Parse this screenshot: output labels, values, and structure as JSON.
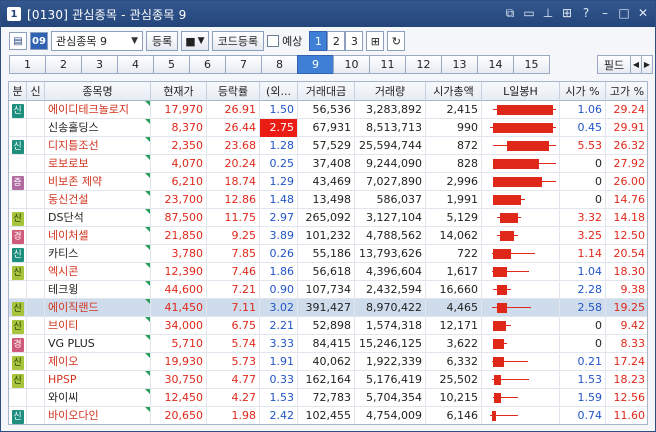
{
  "title": {
    "number": "1",
    "text": "[0130] 관심종목 - 관심종목 9"
  },
  "toolbar": {
    "group_select": "관심종목 9",
    "register": "등록",
    "code_register": "코드등록",
    "forecast": "예상",
    "pages": [
      "1",
      "2",
      "3"
    ],
    "active_page": "1",
    "icon_label_blue": "09"
  },
  "tabs": [
    "1",
    "2",
    "3",
    "4",
    "5",
    "6",
    "7",
    "8",
    "9",
    "10",
    "11",
    "12",
    "13",
    "14",
    "15"
  ],
  "active_tab": "9",
  "tab_field": "필드",
  "columns": [
    "분",
    "신",
    "종목명",
    "현재가",
    "등락률",
    "(외...",
    "거래대금",
    "거래량",
    "시가총액",
    "L일봉H",
    "시가 %",
    "고가 %"
  ],
  "rows": [
    {
      "badge": "신",
      "badge_color": "teal",
      "name": "에이디테크놀로지",
      "name_color": "red",
      "price": "17,970",
      "rate": "26.91",
      "foreign": "1.50",
      "amount": "56,536",
      "volume": "3,283,892",
      "cap": "2,415",
      "open_pct": "1.06",
      "high_pct": "29.24",
      "open_color": "blue",
      "candle": {
        "low": 0.1,
        "high": 1.0,
        "open": 0.15,
        "close": 0.95
      }
    },
    {
      "badge": "",
      "badge_color": "",
      "name": "신송홀딩스",
      "name_color": "black",
      "price": "8,370",
      "rate": "26.44",
      "foreign": "2.75",
      "amount": "67,931",
      "volume": "8,513,713",
      "cap": "990",
      "open_pct": "0.45",
      "high_pct": "29.91",
      "open_color": "blue",
      "highlight_foreign": true,
      "candle": {
        "low": 0.05,
        "high": 1.0,
        "open": 0.1,
        "close": 0.95
      }
    },
    {
      "badge": "신",
      "badge_color": "teal",
      "name": "디지틀조선",
      "name_color": "red",
      "price": "2,350",
      "rate": "23.68",
      "foreign": "1.28",
      "amount": "57,529",
      "volume": "25,594,744",
      "cap": "872",
      "open_pct": "5.53",
      "high_pct": "26.32",
      "open_color": "red",
      "candle": {
        "low": 0.1,
        "high": 1.0,
        "open": 0.3,
        "close": 0.9
      }
    },
    {
      "badge": "",
      "badge_color": "",
      "name": "로보로보",
      "name_color": "red",
      "price": "4,070",
      "rate": "20.24",
      "foreign": "0.25",
      "amount": "37,408",
      "volume": "9,244,090",
      "cap": "828",
      "open_pct": "0",
      "high_pct": "27.92",
      "open_color": "black",
      "candle": {
        "low": 0.1,
        "high": 1.0,
        "open": 0.1,
        "close": 0.75
      }
    },
    {
      "badge": "증",
      "badge_color": "pink",
      "name": "비보존 제약",
      "name_color": "red",
      "price": "6,210",
      "rate": "18.74",
      "foreign": "1.29",
      "amount": "43,469",
      "volume": "7,027,890",
      "cap": "2,996",
      "open_pct": "0",
      "high_pct": "26.00",
      "open_color": "black",
      "candle": {
        "low": 0.1,
        "high": 1.0,
        "open": 0.1,
        "close": 0.8
      }
    },
    {
      "badge": "",
      "badge_color": "",
      "name": "동신건설",
      "name_color": "red",
      "price": "23,700",
      "rate": "12.86",
      "foreign": "1.48",
      "amount": "13,498",
      "volume": "586,037",
      "cap": "1,991",
      "open_pct": "0",
      "high_pct": "14.76",
      "open_color": "black",
      "candle": {
        "low": 0.1,
        "high": 0.55,
        "open": 0.1,
        "close": 0.5
      }
    },
    {
      "badge": "신",
      "badge_color": "lime",
      "name": "DS단석",
      "name_color": "black",
      "price": "87,500",
      "rate": "11.75",
      "foreign": "2.97",
      "amount": "265,092",
      "volume": "3,127,104",
      "cap": "5,129",
      "open_pct": "3.32",
      "high_pct": "14.18",
      "open_color": "red",
      "candle": {
        "low": 0.15,
        "high": 0.5,
        "open": 0.2,
        "close": 0.45
      }
    },
    {
      "badge": "경",
      "badge_color": "rose",
      "name": "네이처셀",
      "name_color": "red",
      "price": "21,850",
      "rate": "9.25",
      "foreign": "3.89",
      "amount": "101,232",
      "volume": "4,788,562",
      "cap": "14,062",
      "open_pct": "3.25",
      "high_pct": "12.50",
      "open_color": "red",
      "candle": {
        "low": 0.15,
        "high": 0.45,
        "open": 0.2,
        "close": 0.4
      }
    },
    {
      "badge": "신",
      "badge_color": "teal",
      "name": "카티스",
      "name_color": "black",
      "price": "3,780",
      "rate": "7.85",
      "foreign": "0.26",
      "amount": "55,186",
      "volume": "13,793,626",
      "cap": "722",
      "open_pct": "1.14",
      "high_pct": "20.54",
      "open_color": "red",
      "candle": {
        "low": 0.08,
        "high": 0.7,
        "open": 0.1,
        "close": 0.35
      }
    },
    {
      "badge": "신",
      "badge_color": "lime",
      "name": "엑시콘",
      "name_color": "red",
      "price": "12,390",
      "rate": "7.46",
      "foreign": "1.86",
      "amount": "56,618",
      "volume": "4,396,604",
      "cap": "1,617",
      "open_pct": "1.04",
      "high_pct": "18.30",
      "open_color": "blue",
      "candle": {
        "low": 0.08,
        "high": 0.62,
        "open": 0.1,
        "close": 0.3
      }
    },
    {
      "badge": "",
      "badge_color": "",
      "name": "테크윙",
      "name_color": "black",
      "price": "44,600",
      "rate": "7.21",
      "foreign": "0.90",
      "amount": "107,734",
      "volume": "2,432,594",
      "cap": "16,660",
      "open_pct": "2.28",
      "high_pct": "9.38",
      "open_color": "blue",
      "candle": {
        "low": 0.1,
        "high": 0.35,
        "open": 0.15,
        "close": 0.3
      }
    },
    {
      "badge": "신",
      "badge_color": "lime",
      "name": "에이직랜드",
      "name_color": "red",
      "price": "41,450",
      "rate": "7.11",
      "foreign": "3.02",
      "amount": "391,427",
      "volume": "8,970,422",
      "cap": "4,465",
      "open_pct": "2.58",
      "high_pct": "19.25",
      "open_color": "blue",
      "selected": true,
      "candle": {
        "low": 0.08,
        "high": 0.65,
        "open": 0.15,
        "close": 0.3
      }
    },
    {
      "badge": "신",
      "badge_color": "lime",
      "name": "브이티",
      "name_color": "red",
      "price": "34,000",
      "rate": "6.75",
      "foreign": "2.21",
      "amount": "52,898",
      "volume": "1,574,318",
      "cap": "12,171",
      "open_pct": "0",
      "high_pct": "9.42",
      "open_color": "black",
      "candle": {
        "low": 0.1,
        "high": 0.35,
        "open": 0.1,
        "close": 0.28
      }
    },
    {
      "badge": "경",
      "badge_color": "rose",
      "name": "VG PLUS",
      "name_color": "black",
      "price": "5,710",
      "rate": "5.74",
      "foreign": "3.33",
      "amount": "84,415",
      "volume": "15,246,125",
      "cap": "3,622",
      "open_pct": "0",
      "high_pct": "8.33",
      "open_color": "black",
      "candle": {
        "low": 0.1,
        "high": 0.3,
        "open": 0.1,
        "close": 0.25
      }
    },
    {
      "badge": "신",
      "badge_color": "lime",
      "name": "제이오",
      "name_color": "red",
      "price": "19,930",
      "rate": "5.73",
      "foreign": "1.91",
      "amount": "40,062",
      "volume": "1,922,339",
      "cap": "6,332",
      "open_pct": "0.21",
      "high_pct": "17.24",
      "open_color": "blue",
      "candle": {
        "low": 0.08,
        "high": 0.6,
        "open": 0.1,
        "close": 0.25
      }
    },
    {
      "badge": "신",
      "badge_color": "lime",
      "name": "HPSP",
      "name_color": "red",
      "price": "30,750",
      "rate": "4.77",
      "foreign": "0.33",
      "amount": "162,164",
      "volume": "5,176,419",
      "cap": "25,502",
      "open_pct": "1.53",
      "high_pct": "18.23",
      "open_color": "blue",
      "candle": {
        "low": 0.08,
        "high": 0.62,
        "open": 0.12,
        "close": 0.22
      }
    },
    {
      "badge": "",
      "badge_color": "",
      "name": "와이씨",
      "name_color": "black",
      "price": "12,450",
      "rate": "4.27",
      "foreign": "1.53",
      "amount": "72,783",
      "volume": "5,704,354",
      "cap": "10,215",
      "open_pct": "1.59",
      "high_pct": "12.56",
      "open_color": "blue",
      "candle": {
        "low": 0.1,
        "high": 0.45,
        "open": 0.12,
        "close": 0.22
      }
    },
    {
      "badge": "신",
      "badge_color": "teal",
      "name": "바이오다인",
      "name_color": "red",
      "price": "20,650",
      "rate": "1.98",
      "foreign": "2.42",
      "amount": "102,455",
      "volume": "4,754,009",
      "cap": "6,146",
      "open_pct": "0.74",
      "high_pct": "11.60",
      "open_color": "blue",
      "candle": {
        "low": 0.05,
        "high": 0.45,
        "open": 0.08,
        "close": 0.15
      }
    }
  ]
}
